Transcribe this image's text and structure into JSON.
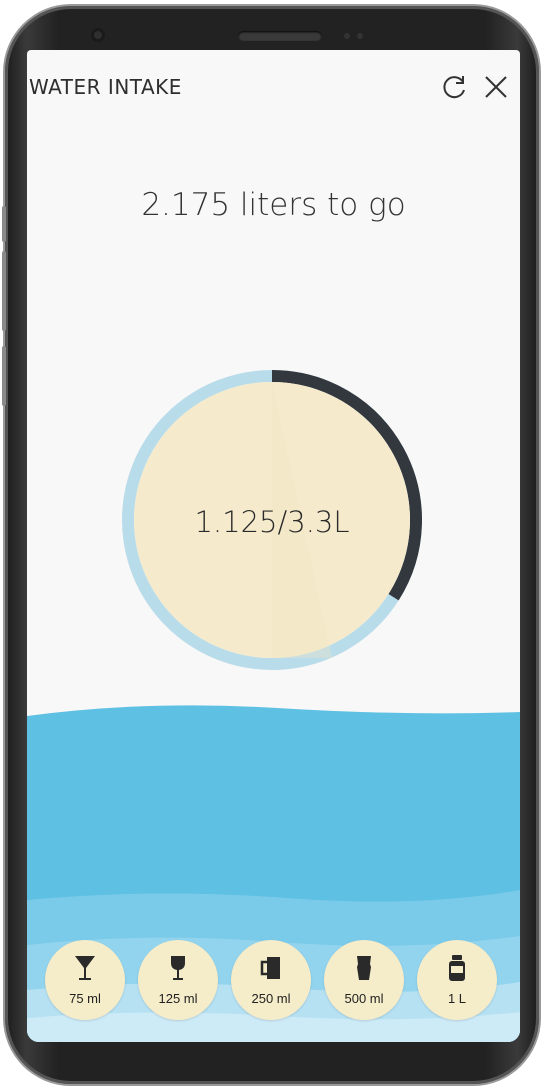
{
  "app": {
    "title": "WATER INTAKE"
  },
  "status": {
    "remaining_text": "2.175 liters to go",
    "total_text": "1.125/3.3L",
    "progress_fraction": 0.34
  },
  "icons": {
    "reset": "refresh-icon",
    "close": "close-icon"
  },
  "drinks": [
    {
      "label": "75 ml",
      "icon": "cocktail-glass-icon"
    },
    {
      "label": "125 ml",
      "icon": "wine-glass-icon"
    },
    {
      "label": "250 ml",
      "icon": "mug-icon"
    },
    {
      "label": "500 ml",
      "icon": "pint-glass-icon"
    },
    {
      "label": "1 L",
      "icon": "bottle-icon"
    }
  ],
  "colors": {
    "ring_track": "#b9dcea",
    "ring_progress": "#33383f",
    "circle_fill": "#f5ebcc",
    "water_main": "#5ec0e3",
    "water_light": "#a6daf0",
    "drink_button": "#f5ecc9"
  }
}
